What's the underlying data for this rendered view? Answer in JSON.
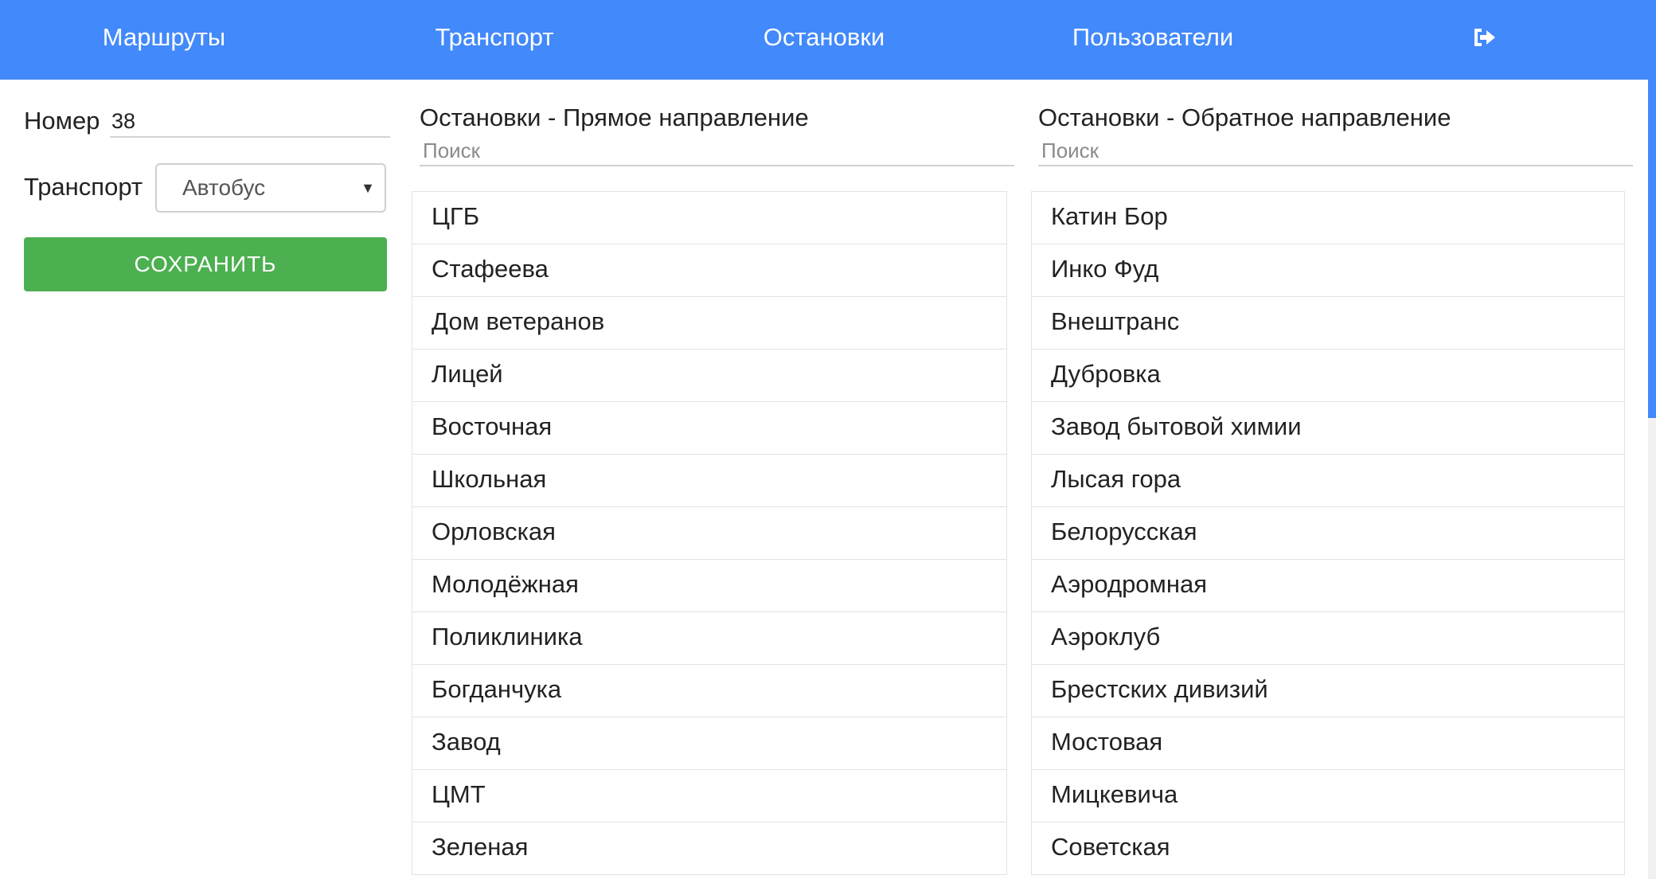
{
  "nav": {
    "routes": "Маршруты",
    "transport": "Транспорт",
    "stops": "Остановки",
    "users": "Пользователи",
    "logout_icon": "sign-out-icon"
  },
  "form": {
    "number_label": "Номер",
    "number_value": "38",
    "transport_label": "Транспорт",
    "transport_selected": "Автобус",
    "save_label": "СОХРАНИТЬ"
  },
  "forward": {
    "title": "Остановки - Прямое направление",
    "search_placeholder": "Поиск",
    "stops": [
      "ЦГБ",
      "Стафеева",
      "Дом ветеранов",
      "Лицей",
      "Восточная",
      "Школьная",
      "Орловская",
      "Молодёжная",
      "Поликлиника",
      "Богданчука",
      "Завод",
      "ЦМТ",
      "Зеленая"
    ]
  },
  "backward": {
    "title": "Остановки - Обратное направление",
    "search_placeholder": "Поиск",
    "stops": [
      "Катин Бор",
      "Инко Фуд",
      "Внештранс",
      "Дубровка",
      "Завод бытовой химии",
      "Лысая гора",
      "Белорусская",
      "Аэродромная",
      "Аэроклуб",
      "Брестских дивизий",
      "Мостовая",
      "Мицкевича",
      "Советская"
    ]
  },
  "colors": {
    "navbar": "#4289fb",
    "save_button": "#4caf50"
  }
}
